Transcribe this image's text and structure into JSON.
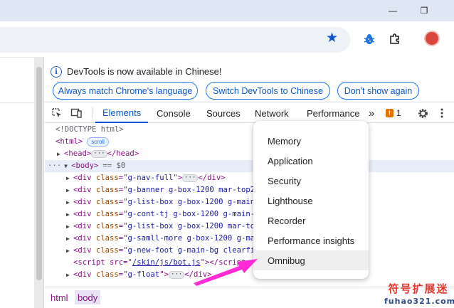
{
  "window": {
    "minimize_glyph": "—",
    "maximize_glyph": "❐"
  },
  "toolbar": {
    "icons": [
      "star-icon",
      "extension-bug-icon",
      "puzzle-icon",
      "profile-avatar"
    ],
    "accent_color": "#0b57d0"
  },
  "infobar": {
    "message": "DevTools is now available in Chinese!",
    "buttons": [
      "Always match Chrome's language",
      "Switch DevTools to Chinese",
      "Don't show again"
    ]
  },
  "tabs": {
    "items": [
      "Elements",
      "Console",
      "Sources",
      "Network",
      "Performance"
    ],
    "active": "Elements",
    "more": "»",
    "issues_count": "1"
  },
  "tree": {
    "doctype": "<!DOCTYPE html>",
    "html_open": "<html>",
    "scroll_badge": "scroll",
    "head": [
      "<head>",
      "</head>"
    ],
    "body_open": "<body>",
    "body_suffix": "== $0",
    "lines": [
      {
        "cls": "g-nav-full",
        "end": "</div>",
        "ell": true
      },
      {
        "cls": "g-banner g-box-1200 mar-top20",
        "end": "",
        "ell": false
      },
      {
        "cls": "g-list-box g-box-1200 g-main-b",
        "end": "",
        "ell": false
      },
      {
        "cls": "g-cont-tj g-box-1200 g-main-bg",
        "end": "",
        "ell": false
      },
      {
        "cls": "g-list-box g-box-1200 mar-top20",
        "end": "",
        "ell": false
      },
      {
        "cls": "g-samll-more g-box-1200 g-main",
        "end": "",
        "ell": false
      },
      {
        "cls": "g-new-foot g-main-bg clearfix",
        "end": "",
        "ell": false
      }
    ],
    "script_pre": "<script src=\"",
    "script_src": "/skin/js/bot.js",
    "script_post": "\"></script",
    "last_cls": "g-float",
    "last_end": "</div>"
  },
  "breadcrumbs": [
    "html",
    "body"
  ],
  "menu": {
    "items": [
      "Memory",
      "Application",
      "Security",
      "Lighthouse",
      "Recorder",
      "Performance insights",
      "Omnibug"
    ],
    "hovered": "Omnibug"
  },
  "watermark": {
    "line1": "符号扩展迷",
    "line2": "fuhao321.com"
  },
  "annotation_color": "#ff2bd6"
}
